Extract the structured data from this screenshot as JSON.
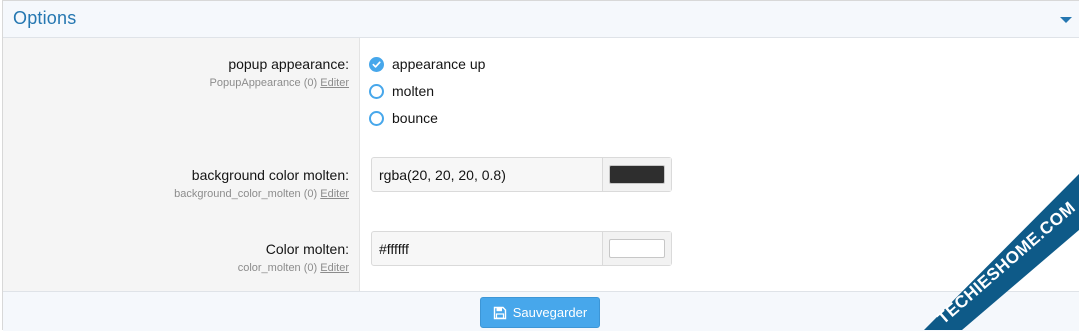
{
  "header": {
    "title": "Options"
  },
  "options": {
    "popup": {
      "label": "popup appearance:",
      "sub": "PopupAppearance (0)",
      "edit": "Editer",
      "radios": [
        {
          "label": "appearance up",
          "checked": true
        },
        {
          "label": "molten",
          "checked": false
        },
        {
          "label": "bounce",
          "checked": false
        }
      ]
    },
    "bg_color": {
      "label": "background color molten:",
      "sub": "background_color_molten (0)",
      "edit": "Editer",
      "value": "rgba(20, 20, 20, 0.8)",
      "swatch": "#2e2e2e"
    },
    "color": {
      "label": "Color molten:",
      "sub": "color_molten (0)",
      "edit": "Editer",
      "value": "#ffffff",
      "swatch": "#ffffff"
    }
  },
  "footer": {
    "save_label": "Sauvegarder"
  },
  "watermark": {
    "text": "TECHIESHOME.COM",
    "color": "#0e5a88"
  },
  "colors": {
    "accent": "#47a7eb",
    "title": "#2577b1"
  }
}
